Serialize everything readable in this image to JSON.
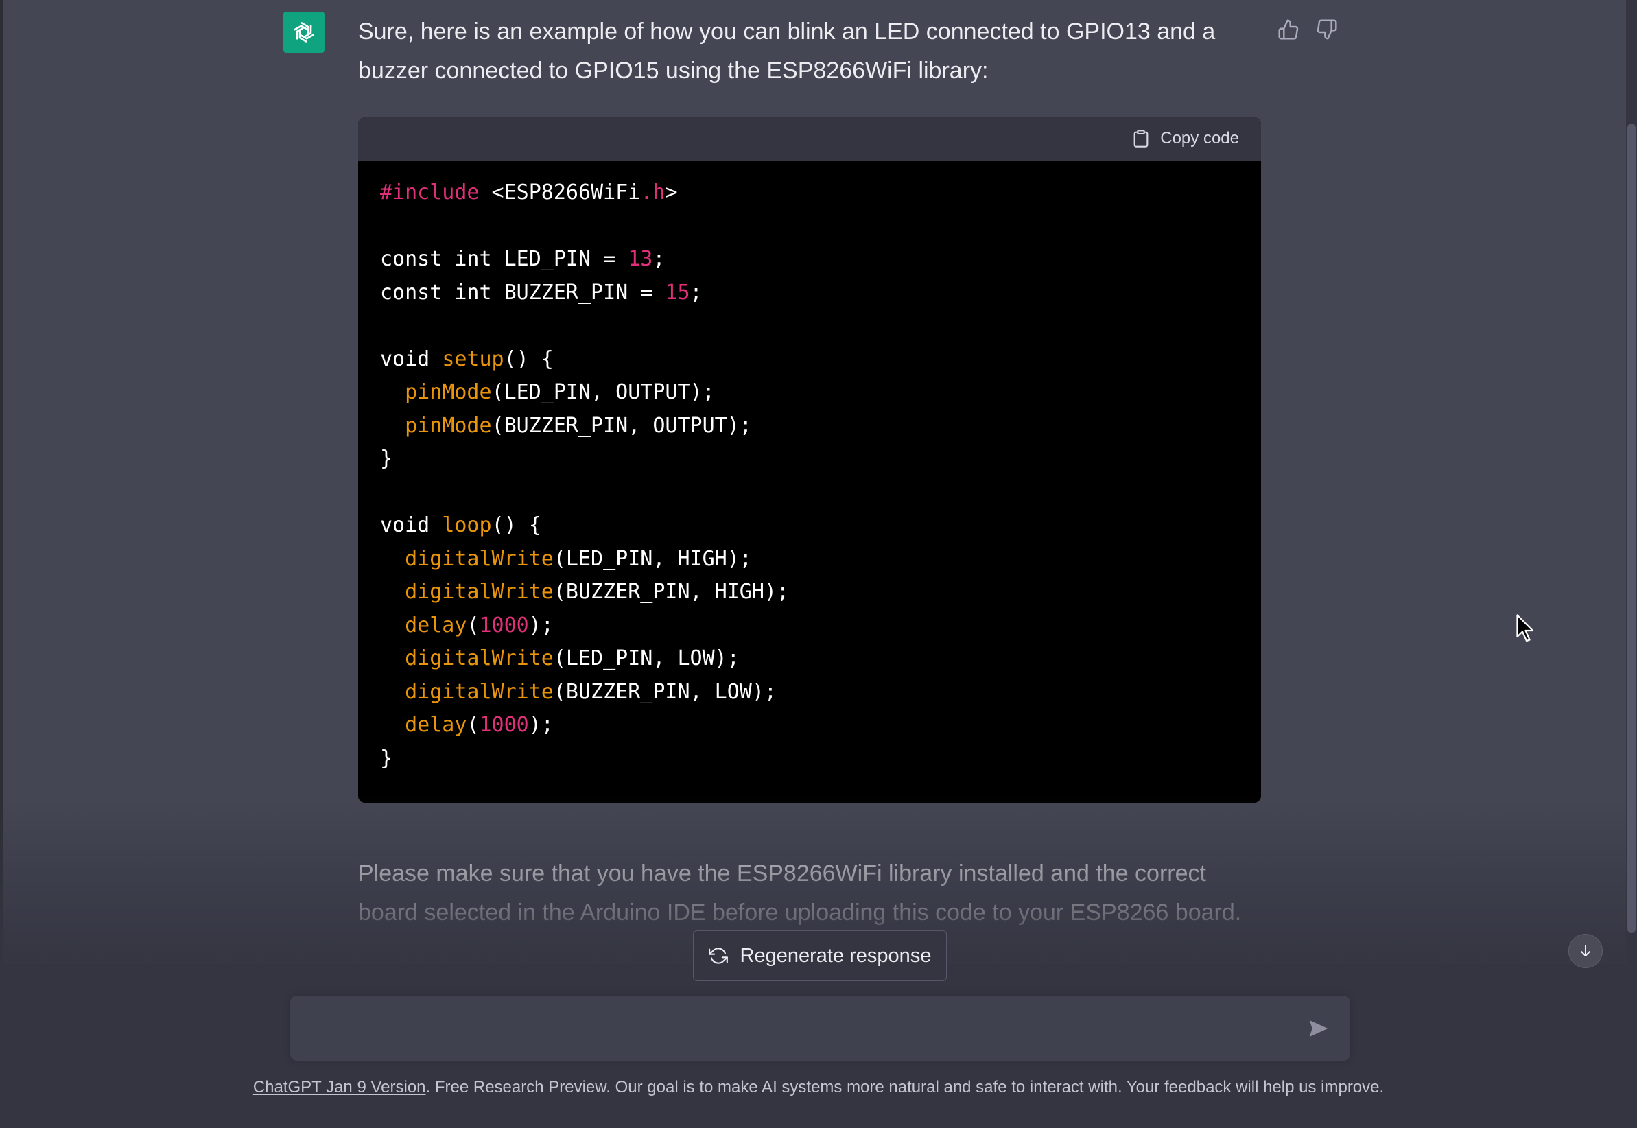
{
  "message": {
    "intro": "Sure, here is an example of how you can blink an LED connected to GPIO13 and a buzzer connected to GPIO15 using the ESP8266WiFi library:",
    "outro": "Please make sure that you have the ESP8266WiFi library installed and the correct board selected in the Arduino IDE before uploading this code to your ESP8266 board."
  },
  "code_block": {
    "copy_label": "Copy code",
    "lines": [
      [
        {
          "t": "pre",
          "v": "#include"
        },
        {
          "t": "plain",
          "v": " <ESP8266WiFi"
        },
        {
          "t": "pre",
          "v": ".h"
        },
        {
          "t": "plain",
          "v": ">"
        }
      ],
      [],
      [
        {
          "t": "plain",
          "v": "const int LED_PIN = "
        },
        {
          "t": "num",
          "v": "13"
        },
        {
          "t": "plain",
          "v": ";"
        }
      ],
      [
        {
          "t": "plain",
          "v": "const int BUZZER_PIN = "
        },
        {
          "t": "num",
          "v": "15"
        },
        {
          "t": "plain",
          "v": ";"
        }
      ],
      [],
      [
        {
          "t": "plain",
          "v": "void "
        },
        {
          "t": "fn",
          "v": "setup"
        },
        {
          "t": "plain",
          "v": "() {"
        }
      ],
      [
        {
          "t": "plain",
          "v": "  "
        },
        {
          "t": "fn",
          "v": "pinMode"
        },
        {
          "t": "plain",
          "v": "(LED_PIN, OUTPUT);"
        }
      ],
      [
        {
          "t": "plain",
          "v": "  "
        },
        {
          "t": "fn",
          "v": "pinMode"
        },
        {
          "t": "plain",
          "v": "(BUZZER_PIN, OUTPUT);"
        }
      ],
      [
        {
          "t": "plain",
          "v": "}"
        }
      ],
      [],
      [
        {
          "t": "plain",
          "v": "void "
        },
        {
          "t": "fn",
          "v": "loop"
        },
        {
          "t": "plain",
          "v": "() {"
        }
      ],
      [
        {
          "t": "plain",
          "v": "  "
        },
        {
          "t": "fn",
          "v": "digitalWrite"
        },
        {
          "t": "plain",
          "v": "(LED_PIN, HIGH);"
        }
      ],
      [
        {
          "t": "plain",
          "v": "  "
        },
        {
          "t": "fn",
          "v": "digitalWrite"
        },
        {
          "t": "plain",
          "v": "(BUZZER_PIN, HIGH);"
        }
      ],
      [
        {
          "t": "plain",
          "v": "  "
        },
        {
          "t": "fn",
          "v": "delay"
        },
        {
          "t": "plain",
          "v": "("
        },
        {
          "t": "num",
          "v": "1000"
        },
        {
          "t": "plain",
          "v": ");"
        }
      ],
      [
        {
          "t": "plain",
          "v": "  "
        },
        {
          "t": "fn",
          "v": "digitalWrite"
        },
        {
          "t": "plain",
          "v": "(LED_PIN, LOW);"
        }
      ],
      [
        {
          "t": "plain",
          "v": "  "
        },
        {
          "t": "fn",
          "v": "digitalWrite"
        },
        {
          "t": "plain",
          "v": "(BUZZER_PIN, LOW);"
        }
      ],
      [
        {
          "t": "plain",
          "v": "  "
        },
        {
          "t": "fn",
          "v": "delay"
        },
        {
          "t": "plain",
          "v": "("
        },
        {
          "t": "num",
          "v": "1000"
        },
        {
          "t": "plain",
          "v": ");"
        }
      ],
      [
        {
          "t": "plain",
          "v": "}"
        }
      ]
    ]
  },
  "regenerate": {
    "label": "Regenerate response"
  },
  "composer": {
    "value": ""
  },
  "footer": {
    "link_text": "ChatGPT Jan 9 Version",
    "text": ". Free Research Preview. Our goal is to make AI systems more natural and safe to interact with. Your feedback will help us improve."
  },
  "icons": {
    "avatar": "openai-logo-icon",
    "feedback_up": "thumbs-up-icon",
    "feedback_down": "thumbs-down-icon",
    "copy": "clipboard-icon",
    "regenerate": "refresh-icon",
    "send": "send-icon",
    "scroll": "arrow-down-icon"
  },
  "colors": {
    "background": "#444654",
    "panel": "#343541",
    "avatar_bg": "#10a37f",
    "code_bg": "#000000",
    "keyword_pink": "#df3079",
    "function_orange": "#e9950c"
  }
}
